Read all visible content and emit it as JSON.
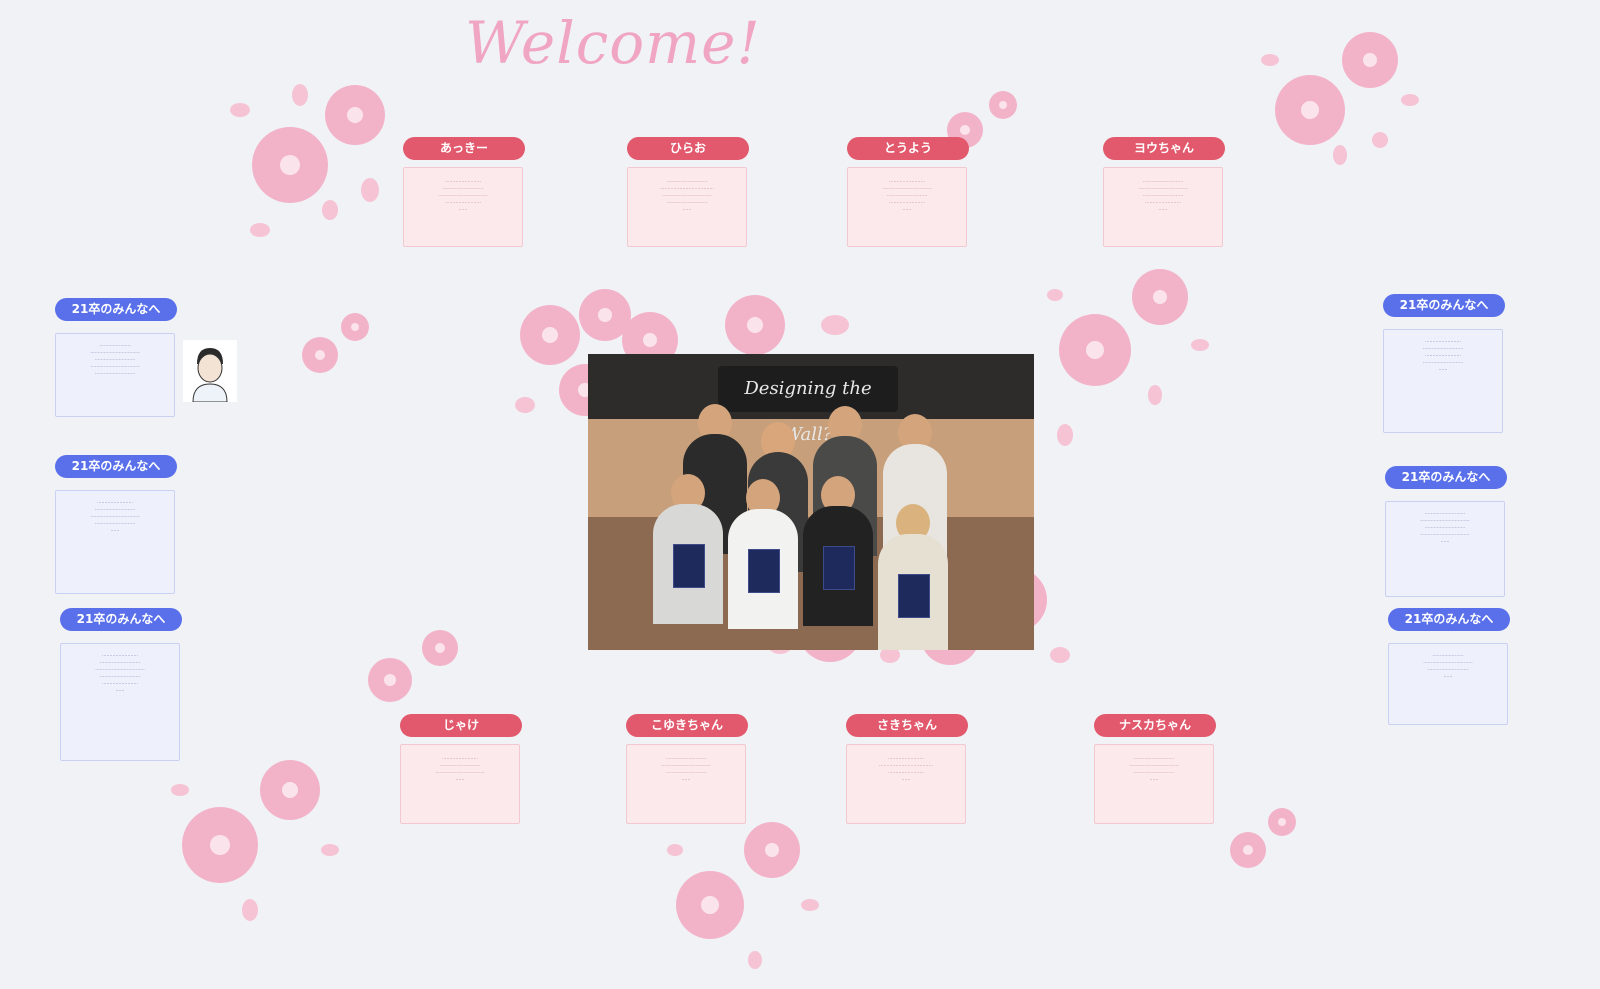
{
  "title": "Welcome!",
  "top_cards": [
    {
      "name": "あっきー",
      "lines": [
        "……………………",
        "………………………",
        "……………………………",
        "……………………",
        "……"
      ]
    },
    {
      "name": "ひらお",
      "lines": [
        "………………………",
        "………………………………",
        "……………………………",
        "………………………",
        "……"
      ]
    },
    {
      "name": "とうよう",
      "lines": [
        "……………………",
        "……………………………",
        "………………………",
        "……………………",
        "……"
      ]
    },
    {
      "name": "ヨウちゃん",
      "lines": [
        "………………………",
        "……………………………",
        "………………………",
        "……………………",
        "……"
      ]
    }
  ],
  "bottom_cards": [
    {
      "name": "じゃけ",
      "lines": [
        "……………………",
        "………………………",
        "……………………………",
        "……"
      ]
    },
    {
      "name": "こゆきちゃん",
      "lines": [
        "………………………",
        "……………………………",
        "………………………",
        "……"
      ]
    },
    {
      "name": "さきちゃん",
      "lines": [
        "……………………",
        "………………………………",
        "……………………",
        "……"
      ]
    },
    {
      "name": "ナスカちゃん",
      "lines": [
        "………………………",
        "……………………………",
        "………………………",
        "……"
      ]
    }
  ],
  "left_cards": [
    {
      "name": "21卒のみんなへ",
      "lines": [
        "…………………",
        "……………………………",
        "………………………",
        "……………………………",
        "………………………"
      ]
    },
    {
      "name": "21卒のみんなへ",
      "lines": [
        "……………………",
        "………………………",
        "……………………………",
        "………………………",
        "……"
      ]
    },
    {
      "name": "21卒のみんなへ",
      "lines": [
        "……………………",
        "………………………",
        "……………………………",
        "………………………",
        "……………………",
        "……"
      ]
    }
  ],
  "right_cards": [
    {
      "name": "21卒のみんなへ",
      "lines": [
        "……………………",
        "………………………",
        "……………………",
        "………………………",
        "……"
      ]
    },
    {
      "name": "21卒のみんなへ",
      "lines": [
        "………………………",
        "……………………………",
        "………………………",
        "……………………………",
        "……"
      ]
    },
    {
      "name": "21卒のみんなへ",
      "lines": [
        "…………………",
        "……………………………",
        "………………………",
        "……"
      ]
    }
  ],
  "photo": {
    "sign_text": "Designing the Wall?"
  },
  "colors": {
    "pink_tag": "#e2596d",
    "blue_tag": "#5970ea",
    "blossom": "#f2b3c9",
    "blossom_center": "#fbe3ec"
  }
}
